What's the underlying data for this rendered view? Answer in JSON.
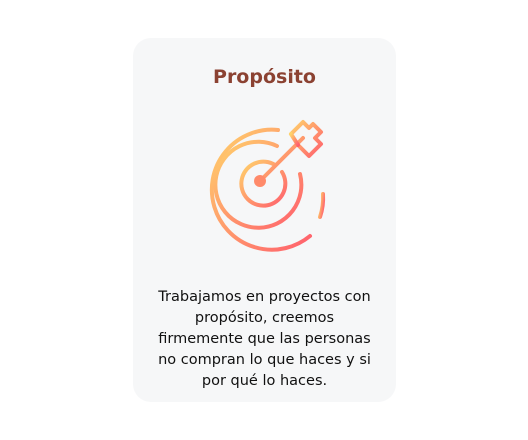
{
  "card": {
    "title": "Propósito",
    "icon": "target-arrow-icon",
    "description": "Trabajamos en proyectos con propósito, creemos firmemente que las personas no compran lo que haces y si por qué lo haces."
  },
  "colors": {
    "card_background": "#f6f7f8",
    "title": "#8b4232",
    "text": "#111111",
    "icon_gradient_start": "#ffd36b",
    "icon_gradient_end": "#ff5f6d"
  }
}
